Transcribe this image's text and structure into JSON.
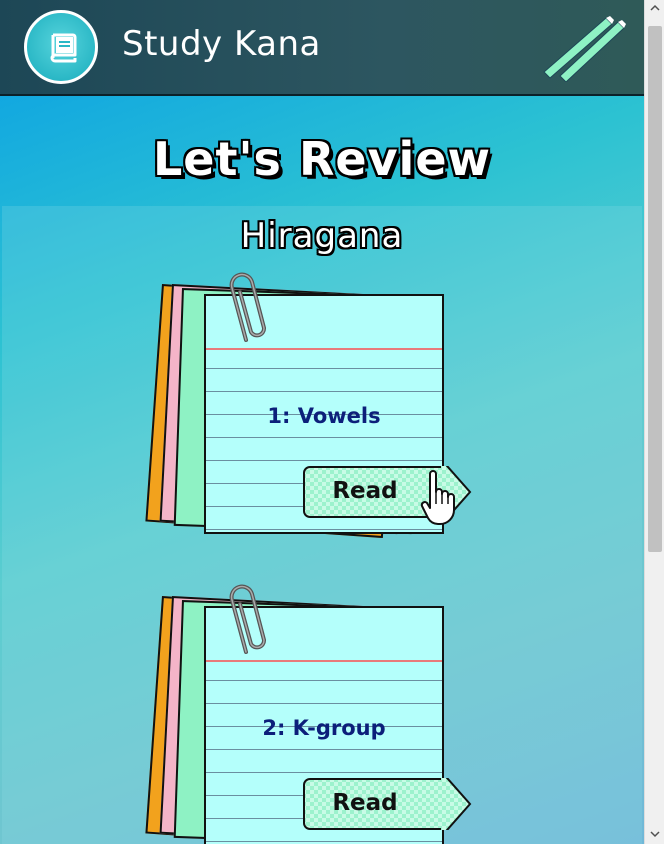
{
  "header": {
    "app_title": "Study Kana",
    "logo_icon": "book-icon",
    "menu_icon": "pencils-icon"
  },
  "main": {
    "title": "Let's Review",
    "section": {
      "title": "Hiragana",
      "decks": [
        {
          "label": "1: Vowels",
          "button_label": "Read"
        },
        {
          "label": "2: K-group",
          "button_label": "Read"
        }
      ]
    }
  },
  "colors": {
    "header_bg": "#2d5660",
    "card_face": "#b4fffb",
    "button_fill": "#98f5ca",
    "label_text": "#0c1f7a"
  }
}
